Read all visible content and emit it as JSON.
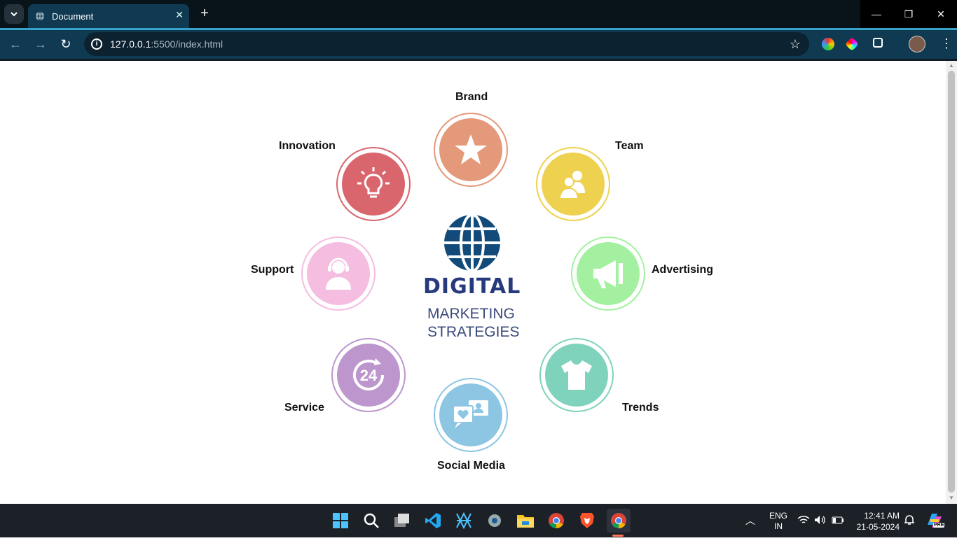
{
  "browser": {
    "tab_title": "Document",
    "url_host": "127.0.0.1",
    "url_rest": ":5500/index.html"
  },
  "page": {
    "title": "DIGITAL",
    "subtitle_line1": "MARKETING",
    "subtitle_line2": "STRATEGIES",
    "items": [
      {
        "label": "Brand",
        "color": "#e4997a",
        "icon": "star-icon"
      },
      {
        "label": "Team",
        "color": "#efd150",
        "icon": "team-icon"
      },
      {
        "label": "Advertising",
        "color": "#a3f1a0",
        "icon": "megaphone-icon"
      },
      {
        "label": "Trends",
        "color": "#7fd3bc",
        "icon": "tshirt-icon"
      },
      {
        "label": "Social Media",
        "color": "#8dc6e3",
        "icon": "chat-icon"
      },
      {
        "label": "Service",
        "color": "#bc96cc",
        "icon": "24h-icon"
      },
      {
        "label": "Support",
        "color": "#f5bde0",
        "icon": "headset-icon"
      },
      {
        "label": "Innovation",
        "color": "#d9666d",
        "icon": "lightbulb-icon"
      }
    ],
    "globe_color": "#124b7a"
  },
  "taskbar": {
    "lang_top": "ENG",
    "lang_bottom": "IN",
    "time": "12:41 AM",
    "date": "21-05-2024",
    "copilot_badge": "PRE"
  }
}
